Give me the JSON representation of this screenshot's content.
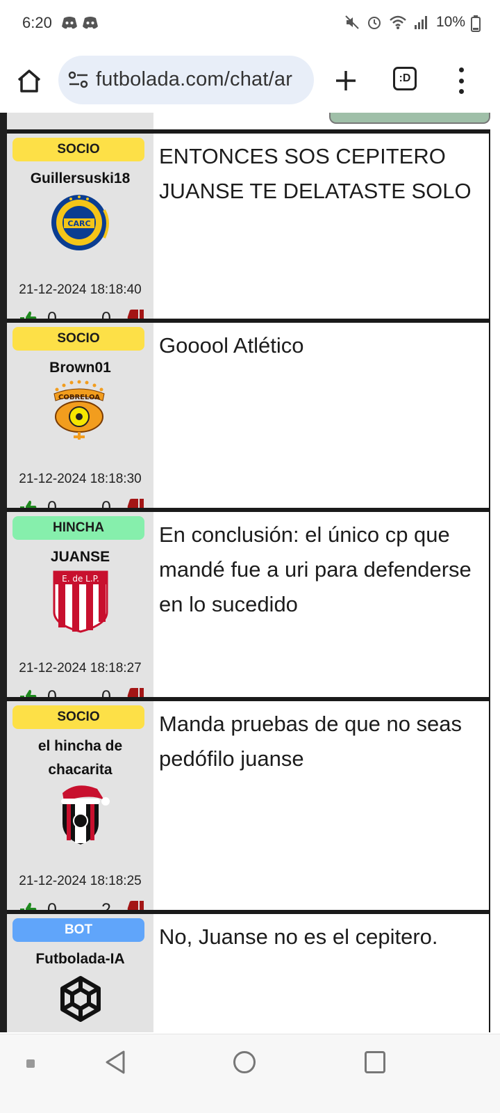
{
  "status": {
    "time": "6:20",
    "battery": "10%",
    "icons": [
      "discord-icon",
      "discord-icon",
      "mute-icon",
      "alarm-icon",
      "wifi-icon",
      "signal-icon",
      "battery-icon"
    ]
  },
  "browser": {
    "url": "futbolada.com/chat/ar",
    "tabs_label": ":D"
  },
  "messages": [
    {
      "badge": "SOCIO",
      "user_lines": [
        "Guillersuski18"
      ],
      "crest": "rosario-central-crest",
      "timestamp": "21-12-2024 18:18:40",
      "up": "0",
      "sep": "-",
      "down": "0",
      "text": "ENTONCES SOS CEPITERO JUANSE TE DELATASTE SOLO"
    },
    {
      "badge": "SOCIO",
      "user_lines": [
        "Brown01"
      ],
      "crest": "cobreloa-crest",
      "timestamp": "21-12-2024 18:18:30",
      "up": "0",
      "sep": "-",
      "down": "0",
      "text": "Gooool Atlético"
    },
    {
      "badge": "HINCHA",
      "user_lines": [
        "JUANSE"
      ],
      "crest": "estudiantes-crest",
      "crest_text": "E. de L.P.",
      "timestamp": "21-12-2024 18:18:27",
      "up": "0",
      "sep": "-",
      "down": "0",
      "text": "En conclusión: el único cp que mandé fue a uri para defenderse en lo sucedido"
    },
    {
      "badge": "SOCIO",
      "user_lines": [
        "el hincha de",
        "chacarita"
      ],
      "crest": "chacarita-crest",
      "timestamp": "21-12-2024 18:18:25",
      "up": "0",
      "sep": "-",
      "down": "2",
      "text": "Manda pruebas de que no seas pedófilo juanse"
    },
    {
      "badge": "BOT",
      "user_lines": [
        "Futbolada-IA"
      ],
      "crest": "openai-logo",
      "text": "No, Juanse no es el cepitero."
    }
  ],
  "colors": {
    "socio": "#fde047",
    "hincha": "#86efac",
    "bot": "#60a5fa",
    "sidebar": "#e3e3e3",
    "like": "#1f8a1f",
    "dislike": "#a31515"
  }
}
